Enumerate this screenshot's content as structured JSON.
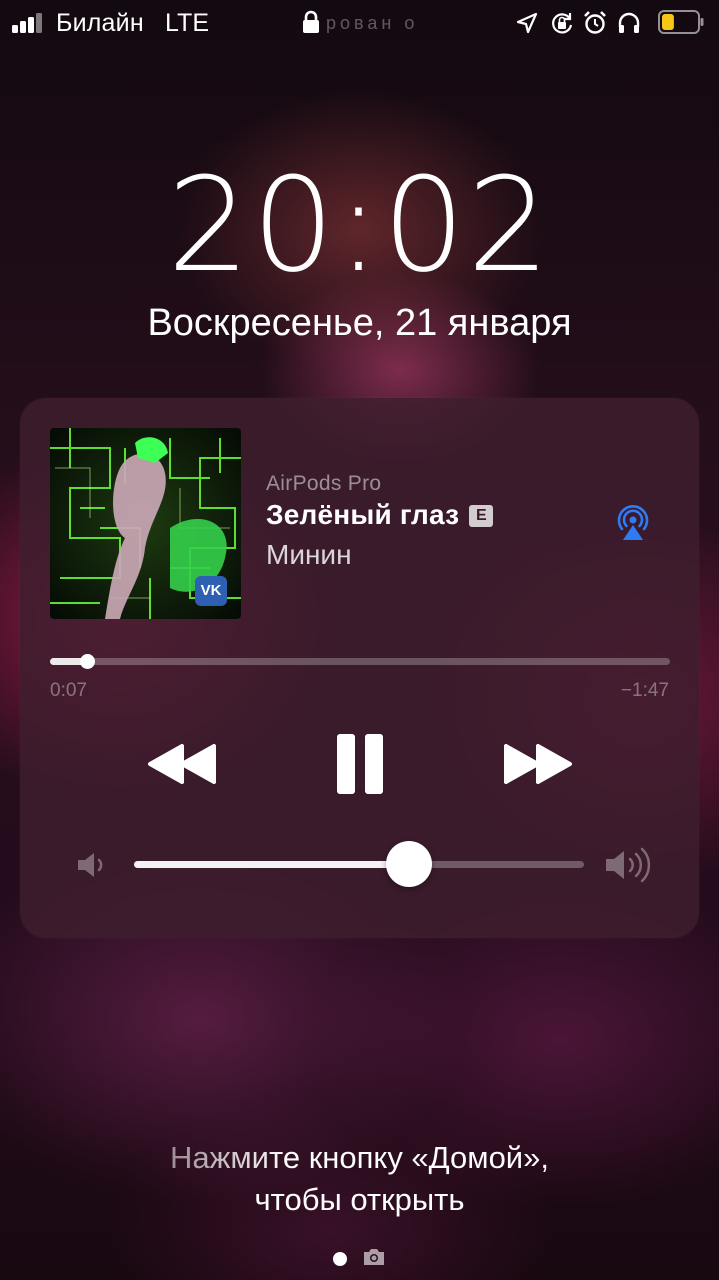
{
  "status_bar": {
    "carrier": "Билайн",
    "network": "LTE",
    "lock_text": "рован о",
    "icons": [
      "signal-bars-icon",
      "lock-icon",
      "location-arrow-icon",
      "rotation-lock-icon",
      "alarm-clock-icon",
      "headphones-icon",
      "battery-icon"
    ],
    "battery_level": 0.35,
    "battery_color": "#f5c518"
  },
  "lock_screen": {
    "time": "20:02",
    "date": "Воскресенье, 21 января"
  },
  "now_playing": {
    "device": "AirPods Pro",
    "title": "Зелёный глаз",
    "explicit_badge": "E",
    "artist": "Минин",
    "elapsed": "0:07",
    "remaining": "−1:47",
    "progress": 0.06,
    "volume": 0.61,
    "airplay_color": "#2f7bf6",
    "artwork_badge": "VK",
    "controls": [
      "rewind-icon",
      "pause-icon",
      "fast-forward-icon"
    ]
  },
  "unlock_hint": {
    "line1": "Нажмите кнопку «Домой»,",
    "line2": "чтобы открыть"
  }
}
